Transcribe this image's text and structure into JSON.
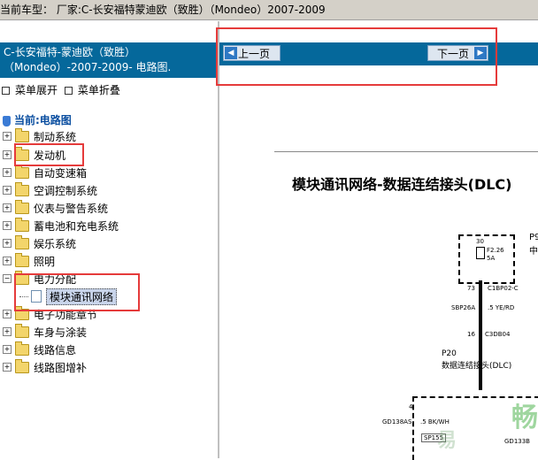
{
  "top_bar": {
    "text": "当前车型： 厂家:C-长安福特蒙迪欧（致胜）（Mondeo）2007-2009"
  },
  "left_header": {
    "line1": "C-长安福特-蒙迪欧（致胜）",
    "line2": "（Mondeo）-2007-2009- 电路图."
  },
  "menu": {
    "expand": "菜单展开",
    "collapse": "菜单折叠"
  },
  "tree": {
    "current": "当前:电路图",
    "items": [
      "制动系统",
      "发动机",
      "自动变速箱",
      "空调控制系统",
      "仪表与警告系统",
      "蓄电池和充电系统",
      "娱乐系统",
      "照明",
      "电力分配",
      "模块通讯网络",
      "电子功能章节",
      "车身与涂装",
      "线路信息",
      "线路图增补"
    ]
  },
  "nav": {
    "prev": "上一页",
    "next": "下一页"
  },
  "diagram": {
    "title": "模块通讯网络-数据连结接头(DLC)",
    "p_label": "P9",
    "p_sub": "中",
    "fuse_text": "F2.26",
    "fuse_amp": "5A",
    "num30": "30",
    "pin73": "73",
    "conn1": "C1BP02-C",
    "wire1": "SBP26A",
    "wire1_color": ".5 YE/RD",
    "pin16": "16",
    "conn2": "C3DB04",
    "p20": "P20",
    "p20_desc": "数据连结接头(DLC)",
    "pin4": "4",
    "wire2": "GD138AS",
    "wire2_color": ".5 BK/WH",
    "part": "SP155",
    "right_code": "GD133B"
  },
  "watermark": {
    "text1": "畅",
    "text2": "易"
  }
}
